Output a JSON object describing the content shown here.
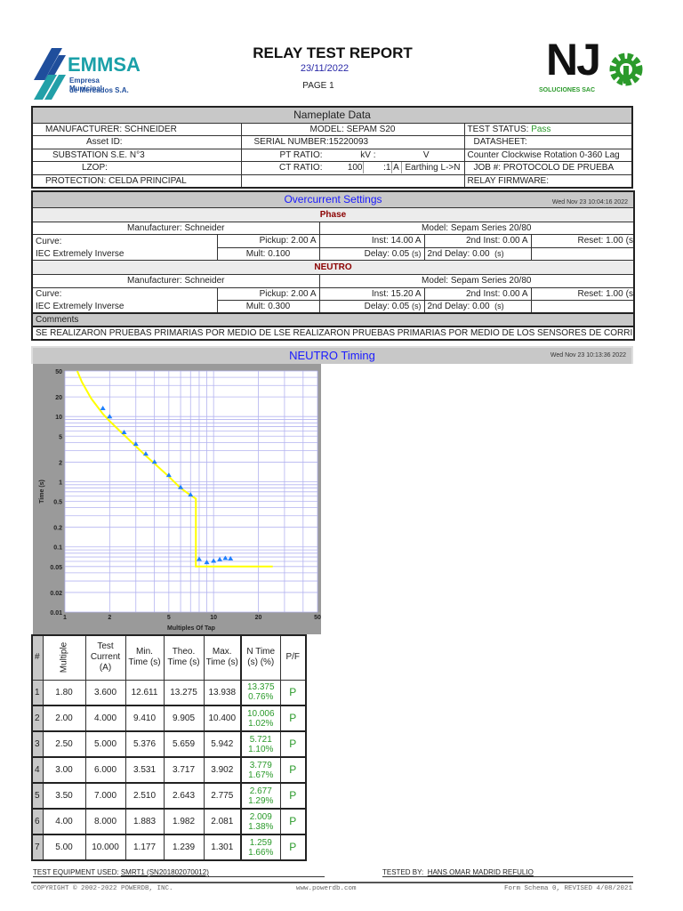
{
  "header": {
    "title": "RELAY TEST REPORT",
    "date": "23/11/2022",
    "page": "PAGE  1",
    "left_logo": {
      "name": "EMMSA",
      "sub1": "Empresa Municipal",
      "sub2": "de Mercados S.A."
    },
    "right_logo": {
      "name": "NJ",
      "sub": "SOLUCIONES SAC"
    }
  },
  "nameplate": {
    "title": "Nameplate Data",
    "manufacturer": "MANUFACTURER: SCHNEIDER",
    "asset": "Asset ID:",
    "substation": "SUBSTATION S.E. N°3",
    "lzop": "LZOP:",
    "protection": "PROTECTION: CELDA PRINCIPAL",
    "model": "MODEL:  SEPAM S20",
    "serial": "SERIAL NUMBER:15220093",
    "pt_label": "PT RATIO:",
    "pt_kv": "kV :",
    "pt_v": "V",
    "ct_label": "CT RATIO:",
    "ct_value": "100",
    "ct_ratio": ":1",
    "ct_unit": "A",
    "earthing": "Earthing L->N",
    "status_label": "TEST STATUS:",
    "status_value": "Pass",
    "datasheet": "DATASHEET:",
    "rotation": "Counter Clockwise Rotation 0-360 Lag",
    "job": "JOB #:  PROTOCOLO DE PRUEBA",
    "firmware": "RELAY FIRMWARE:"
  },
  "overcurrent": {
    "title": "Overcurrent Settings",
    "timestamp": "Wed Nov 23 10:04:16 2022",
    "groups": [
      {
        "name": "Phase",
        "manufacturer": "Manufacturer:  Schneider",
        "model": "Model:  Sepam Series 20/80",
        "curve_label": "Curve:",
        "curve": "IEC Extremely Inverse",
        "pickup": "Pickup:    2.00    A",
        "mult": "Mult:  0.100",
        "inst": "Inst:  14.00   A",
        "delay": "Delay:    0.05",
        "delay_unit": "(s)",
        "inst2": "2nd Inst:    0.00     A",
        "delay2": "2nd Delay:    0.00",
        "delay2_unit": "(s)",
        "reset": "Reset:    1.00",
        "reset_unit": "(s"
      },
      {
        "name": "NEUTRO",
        "manufacturer": "Manufacturer:  Schneider",
        "model": "Model:  Sepam Series 20/80",
        "curve_label": "Curve:",
        "curve": "IEC Extremely Inverse",
        "pickup": "Pickup:    2.00    A",
        "mult": "Mult:  0.300",
        "inst": "Inst:  15.20   A",
        "delay": "Delay:    0.05",
        "delay_unit": "(s)",
        "inst2": "2nd Inst:    0.00     A",
        "delay2": "2nd Delay:    0.00",
        "delay2_unit": "(s)",
        "reset": "Reset:    1.00",
        "reset_unit": "(s"
      }
    ],
    "comments_label": "Comments",
    "comments": "SE REALIZARON PRUEBAS PRIMARIAS POR MEDIO DE LSE REALIZARON PRUEBAS PRIMARIAS POR MEDIO DE LOS SENSORES DE CORRIE"
  },
  "timing": {
    "title": "NEUTRO Timing",
    "timestamp": "Wed Nov 23 10:13:36 2022"
  },
  "chart_data": {
    "type": "scatter",
    "xlabel": "Multiples Of Tap",
    "ylabel": "Time (s)",
    "xscale": "log",
    "yscale": "log",
    "xlim": [
      1,
      50
    ],
    "ylim": [
      0.01,
      50
    ],
    "xticks": [
      1,
      2,
      5,
      10,
      20,
      50
    ],
    "yticks": [
      0.01,
      0.02,
      0.05,
      0.1,
      0.2,
      0.5,
      1,
      2,
      5,
      10,
      20,
      50
    ],
    "grid": true,
    "curve": {
      "name": "Theoretical curve",
      "color": "#ffff00",
      "x": [
        1.21,
        1.3,
        1.5,
        1.8,
        2,
        2.5,
        3,
        3.5,
        4,
        5,
        6,
        7,
        7.6,
        7.6,
        25
      ],
      "y": [
        50,
        34,
        19,
        11,
        8.5,
        5.2,
        3.5,
        2.5,
        1.9,
        1.2,
        0.8,
        0.62,
        0.55,
        0.05,
        0.05
      ]
    },
    "points": {
      "name": "Test points",
      "color": "#1e7fff",
      "x": [
        1.8,
        2,
        2.5,
        3,
        3.5,
        4,
        5,
        6,
        7,
        8,
        9,
        10,
        11,
        12,
        13
      ],
      "y": [
        13.375,
        10.006,
        5.721,
        3.779,
        2.677,
        2.009,
        1.259,
        0.82,
        0.63,
        0.065,
        0.058,
        0.061,
        0.064,
        0.067,
        0.066
      ]
    }
  },
  "results": {
    "headers": [
      "#",
      "Multiple",
      "Test Current (A)",
      "Min. Time (s)",
      "Theo. Time (s)",
      "Max. Time (s)",
      "N Time (s) (%)",
      "P/F"
    ],
    "rows": [
      {
        "n": "1",
        "mult": "1.80",
        "cur": "3.600",
        "min": "12.611",
        "theo": "13.275",
        "max": "13.938",
        "time": "13.375",
        "pct": "0.76%",
        "pf": "P"
      },
      {
        "n": "2",
        "mult": "2.00",
        "cur": "4.000",
        "min": "9.410",
        "theo": "9.905",
        "max": "10.400",
        "time": "10.006",
        "pct": "1.02%",
        "pf": "P"
      },
      {
        "n": "3",
        "mult": "2.50",
        "cur": "5.000",
        "min": "5.376",
        "theo": "5.659",
        "max": "5.942",
        "time": "5.721",
        "pct": "1.10%",
        "pf": "P"
      },
      {
        "n": "4",
        "mult": "3.00",
        "cur": "6.000",
        "min": "3.531",
        "theo": "3.717",
        "max": "3.902",
        "time": "3.779",
        "pct": "1.67%",
        "pf": "P"
      },
      {
        "n": "5",
        "mult": "3.50",
        "cur": "7.000",
        "min": "2.510",
        "theo": "2.643",
        "max": "2.775",
        "time": "2.677",
        "pct": "1.29%",
        "pf": "P"
      },
      {
        "n": "6",
        "mult": "4.00",
        "cur": "8.000",
        "min": "1.883",
        "theo": "1.982",
        "max": "2.081",
        "time": "2.009",
        "pct": "1.38%",
        "pf": "P"
      },
      {
        "n": "7",
        "mult": "5.00",
        "cur": "10.000",
        "min": "1.177",
        "theo": "1.239",
        "max": "1.301",
        "time": "1.259",
        "pct": "1.66%",
        "pf": "P"
      }
    ]
  },
  "footer": {
    "equip_label": "TEST EQUIPMENT USED:",
    "equip": "SMRT1 (SN201802070012)",
    "tested_label": "TESTED BY:",
    "tested": "HANS OMAR MADRID REFULIO",
    "copyright": "COPYRIGHT © 2002-2022 POWERDB, INC.",
    "url": "www.powerdb.com",
    "form": "Form Schema 0, REVISED 4/08/2021"
  }
}
